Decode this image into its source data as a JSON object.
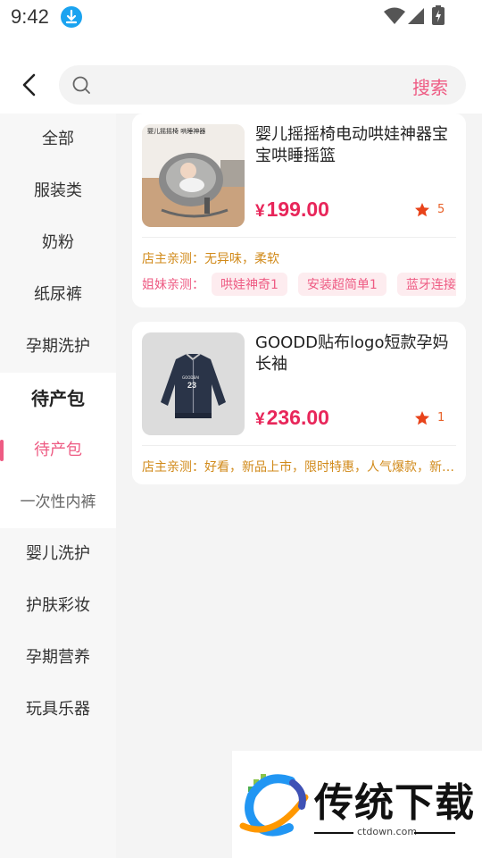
{
  "status": {
    "time": "9:42"
  },
  "search": {
    "placeholder": "",
    "value": "",
    "button_label": "搜索"
  },
  "sidebar": {
    "items": [
      {
        "label": "全部"
      },
      {
        "label": "服装类"
      },
      {
        "label": "奶粉"
      },
      {
        "label": "纸尿裤"
      },
      {
        "label": "孕期洗护"
      },
      {
        "label": "待产包"
      },
      {
        "label": "待产包"
      },
      {
        "label": "一次性内裤"
      },
      {
        "label": "婴儿洗护"
      },
      {
        "label": "护肤彩妆"
      },
      {
        "label": "孕期营养"
      },
      {
        "label": "玩具乐器"
      }
    ]
  },
  "products": [
    {
      "title": "婴儿摇摇椅电动哄娃神器宝宝哄睡摇篮",
      "currency": "¥",
      "price": "199.00",
      "likes": "5",
      "review_label": "店主亲测：",
      "review_text": "无异味，柔软",
      "tags_label": "姐妹亲测：",
      "tags": [
        "哄娃神奇1",
        "安装超简单1",
        "蓝牙连接"
      ],
      "image_text": "婴儿摇摇椅 哄睡神器"
    },
    {
      "title": "GOODD贴布logo短款孕妈长袖",
      "currency": "¥",
      "price": "236.00",
      "likes": "1",
      "review_label": "店主亲测：",
      "review_text": "好看，新品上市，限时特惠，人气爆款，新品上市",
      "image_text": "23"
    }
  ],
  "watermark": {
    "title": "传统下载",
    "url": "ctdown.com"
  },
  "colors": {
    "accent": "#ee5b83",
    "price": "#e8265a",
    "review": "#d18a1a",
    "star": "#e8431a"
  }
}
